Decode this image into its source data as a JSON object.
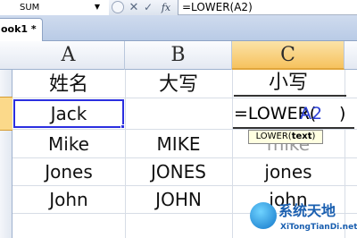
{
  "formula_bar": {
    "name_box": "SUM",
    "dropdown_icon": "chevron-down-icon",
    "cancel_icon": "✕",
    "enter_icon": "✓",
    "function_icon": "fx",
    "formula": "=LOWER(A2)"
  },
  "workbook": {
    "tab_label": "ook1 *"
  },
  "columns": [
    "A",
    "B",
    "C"
  ],
  "rows": [
    {
      "a": "姓名",
      "b": "大写",
      "c": "小写"
    },
    {
      "a": "Jack",
      "b": "",
      "c": ""
    },
    {
      "a": "Mike",
      "b": "MIKE",
      "c": "mike"
    },
    {
      "a": "Jones",
      "b": "JONES",
      "c": "jones"
    },
    {
      "a": "John",
      "b": "JOHN",
      "c": "john"
    }
  ],
  "edit": {
    "prefix": "=LOWER(",
    "argument": "A2",
    "suffix": ")",
    "tooltip_func": "LOWER(",
    "tooltip_arg": "text",
    "tooltip_close": ")"
  },
  "colors": {
    "selection": "#2b2fe0",
    "active_column": "#f6c25e",
    "reference": "#2b3fd6"
  },
  "watermark": {
    "title": "系统天地",
    "subtitle": "XiTongTianDi.net"
  }
}
